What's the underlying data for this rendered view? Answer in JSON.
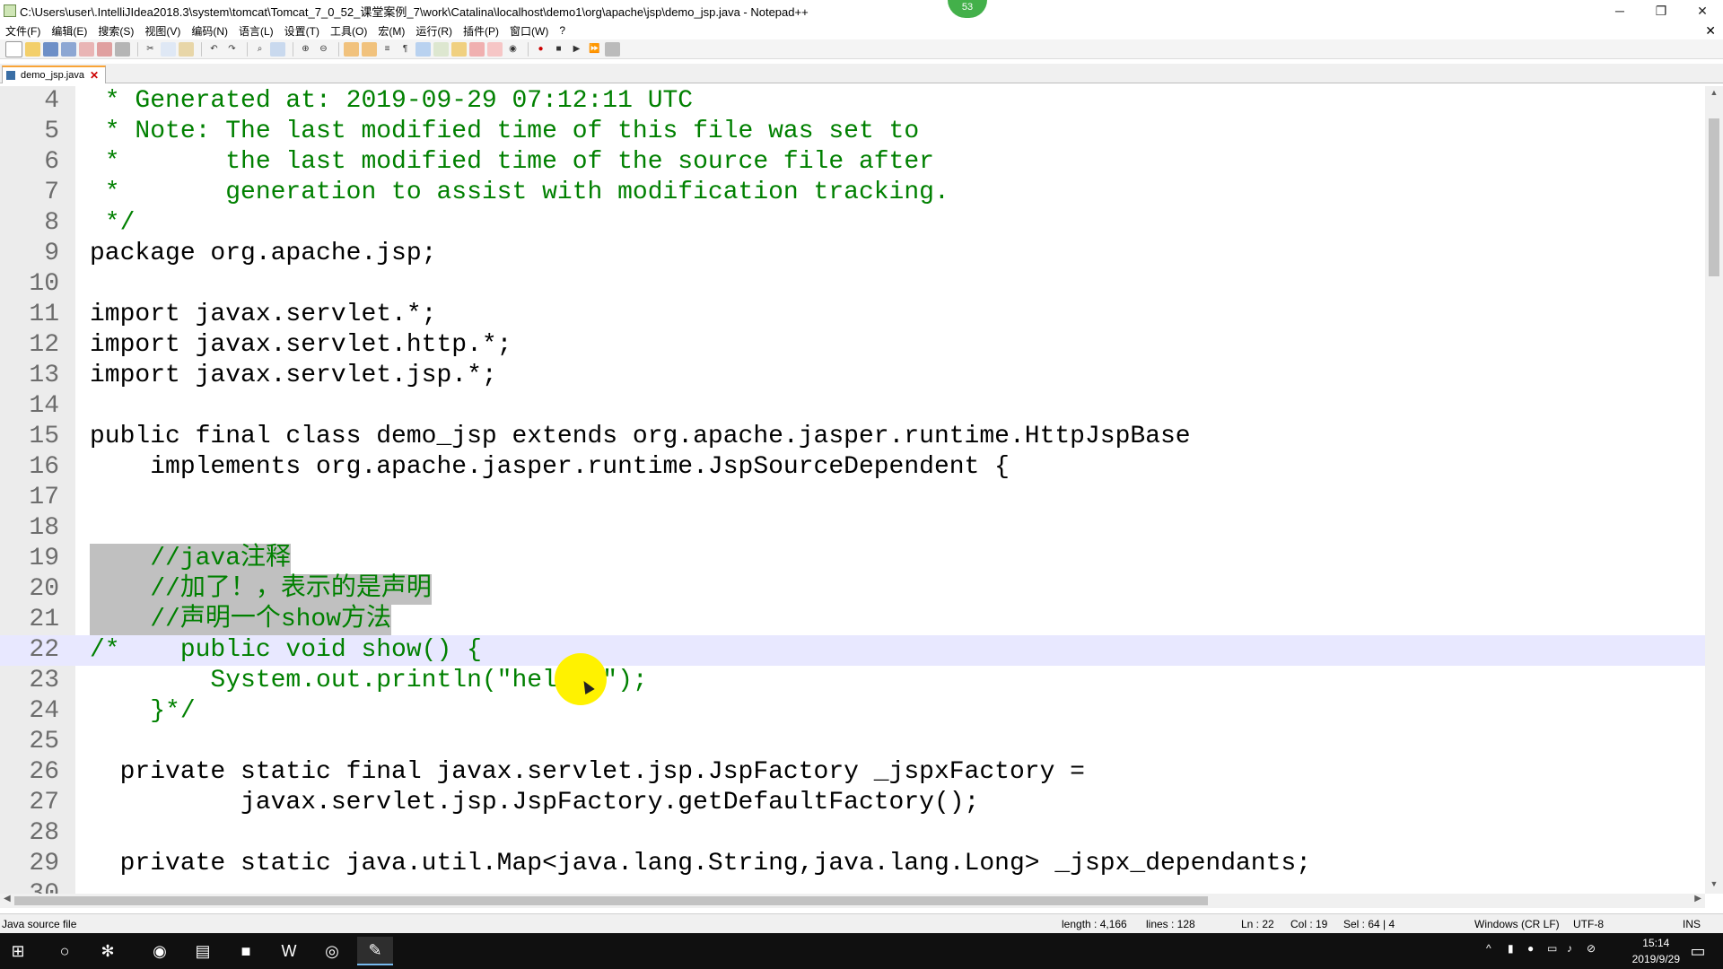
{
  "window": {
    "title": "C:\\Users\\user\\.IntelliJIdea2018.3\\system\\tomcat\\Tomcat_7_0_52_课堂案例_7\\work\\Catalina\\localhost\\demo1\\org\\apache\\jsp\\demo_jsp.java - Notepad++",
    "badge": "53",
    "min_label": "─",
    "max_label": "❐",
    "close_label": "✕"
  },
  "menu": {
    "items": [
      "文件(F)",
      "编辑(E)",
      "搜索(S)",
      "视图(V)",
      "编码(N)",
      "语言(L)",
      "设置(T)",
      "工具(O)",
      "宏(M)",
      "运行(R)",
      "插件(P)",
      "窗口(W)",
      "?"
    ],
    "doc_close": "✕"
  },
  "tab": {
    "label": "demo_jsp.java",
    "close": "✕"
  },
  "editor": {
    "lines": [
      {
        "n": "4",
        "text": " * Generated at: 2019-09-29 07:12:11 UTC"
      },
      {
        "n": "5",
        "text": " * Note: The last modified time of this file was set to"
      },
      {
        "n": "6",
        "text": " *       the last modified time of the source file after"
      },
      {
        "n": "7",
        "text": " *       generation to assist with modification tracking."
      },
      {
        "n": "8",
        "text": " */"
      },
      {
        "n": "9",
        "text": "package org.apache.jsp;"
      },
      {
        "n": "10",
        "text": ""
      },
      {
        "n": "11",
        "text": "import javax.servlet.*;"
      },
      {
        "n": "12",
        "text": "import javax.servlet.http.*;"
      },
      {
        "n": "13",
        "text": "import javax.servlet.jsp.*;"
      },
      {
        "n": "14",
        "text": ""
      },
      {
        "n": "15",
        "text": "public final class demo_jsp extends org.apache.jasper.runtime.HttpJspBase"
      },
      {
        "n": "16",
        "text": "    implements org.apache.jasper.runtime.JspSourceDependent {"
      },
      {
        "n": "17",
        "text": ""
      },
      {
        "n": "18",
        "text": ""
      },
      {
        "n": "19",
        "text": "    //java注释"
      },
      {
        "n": "20",
        "text": "    //加了！，表示的是声明"
      },
      {
        "n": "21",
        "text": "    //声明一个show方法"
      },
      {
        "n": "22",
        "text": "/*    public void show() {"
      },
      {
        "n": "23",
        "text": "        System.out.println(\"hello!\");"
      },
      {
        "n": "24",
        "text": "    }*/"
      },
      {
        "n": "25",
        "text": ""
      },
      {
        "n": "26",
        "text": "  private static final javax.servlet.jsp.JspFactory _jspxFactory ="
      },
      {
        "n": "27",
        "text": "          javax.servlet.jsp.JspFactory.getDefaultFactory();"
      },
      {
        "n": "28",
        "text": ""
      },
      {
        "n": "29",
        "text": "  private static java.util.Map<java.lang.String,java.lang.Long> _jspx_dependants;"
      },
      {
        "n": "30",
        "text": ""
      }
    ],
    "current_line": "22"
  },
  "status": {
    "file_type": "Java source file",
    "length": "length : 4,166",
    "lines": "lines : 128",
    "ln": "Ln : 22",
    "col": "Col : 19",
    "sel": "Sel : 64 | 4",
    "eol": "Windows (CR LF)",
    "encoding": "UTF-8",
    "mode": "INS"
  },
  "taskbar": {
    "time": "15:14",
    "date": "2019/9/29"
  },
  "colors": {
    "comment": "#008000",
    "keyword": "#8000ff",
    "keyword_bold": "#0000ff",
    "current_line": "#e8e8ff",
    "selection": "#c0c0c0",
    "tab_accent": "#f9a437"
  }
}
